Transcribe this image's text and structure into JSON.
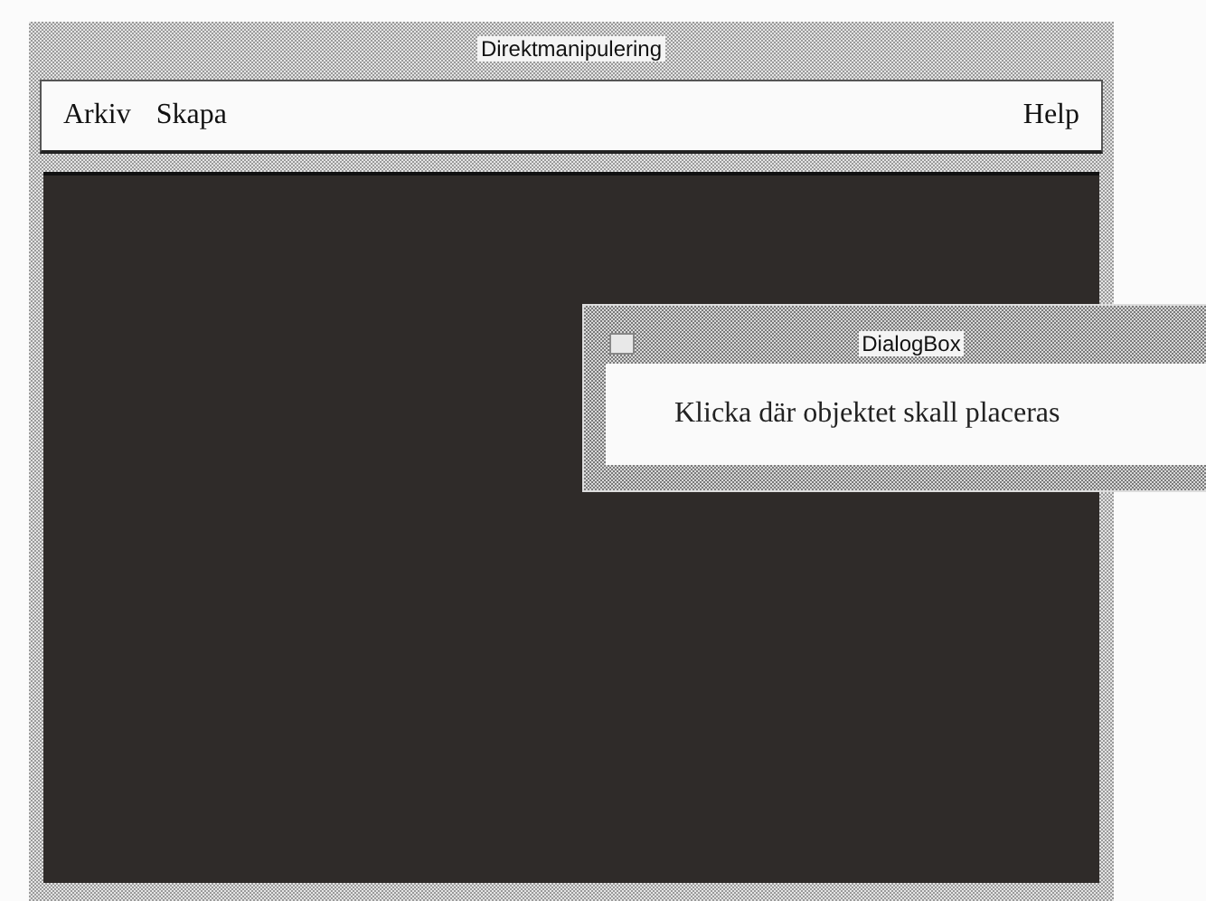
{
  "window": {
    "title": "Direktmanipulering"
  },
  "menu": {
    "left": [
      "Arkiv",
      "Skapa"
    ],
    "right": [
      "Help"
    ]
  },
  "dialog": {
    "title": "DialogBox",
    "message": "Klicka där objektet skall placeras"
  }
}
